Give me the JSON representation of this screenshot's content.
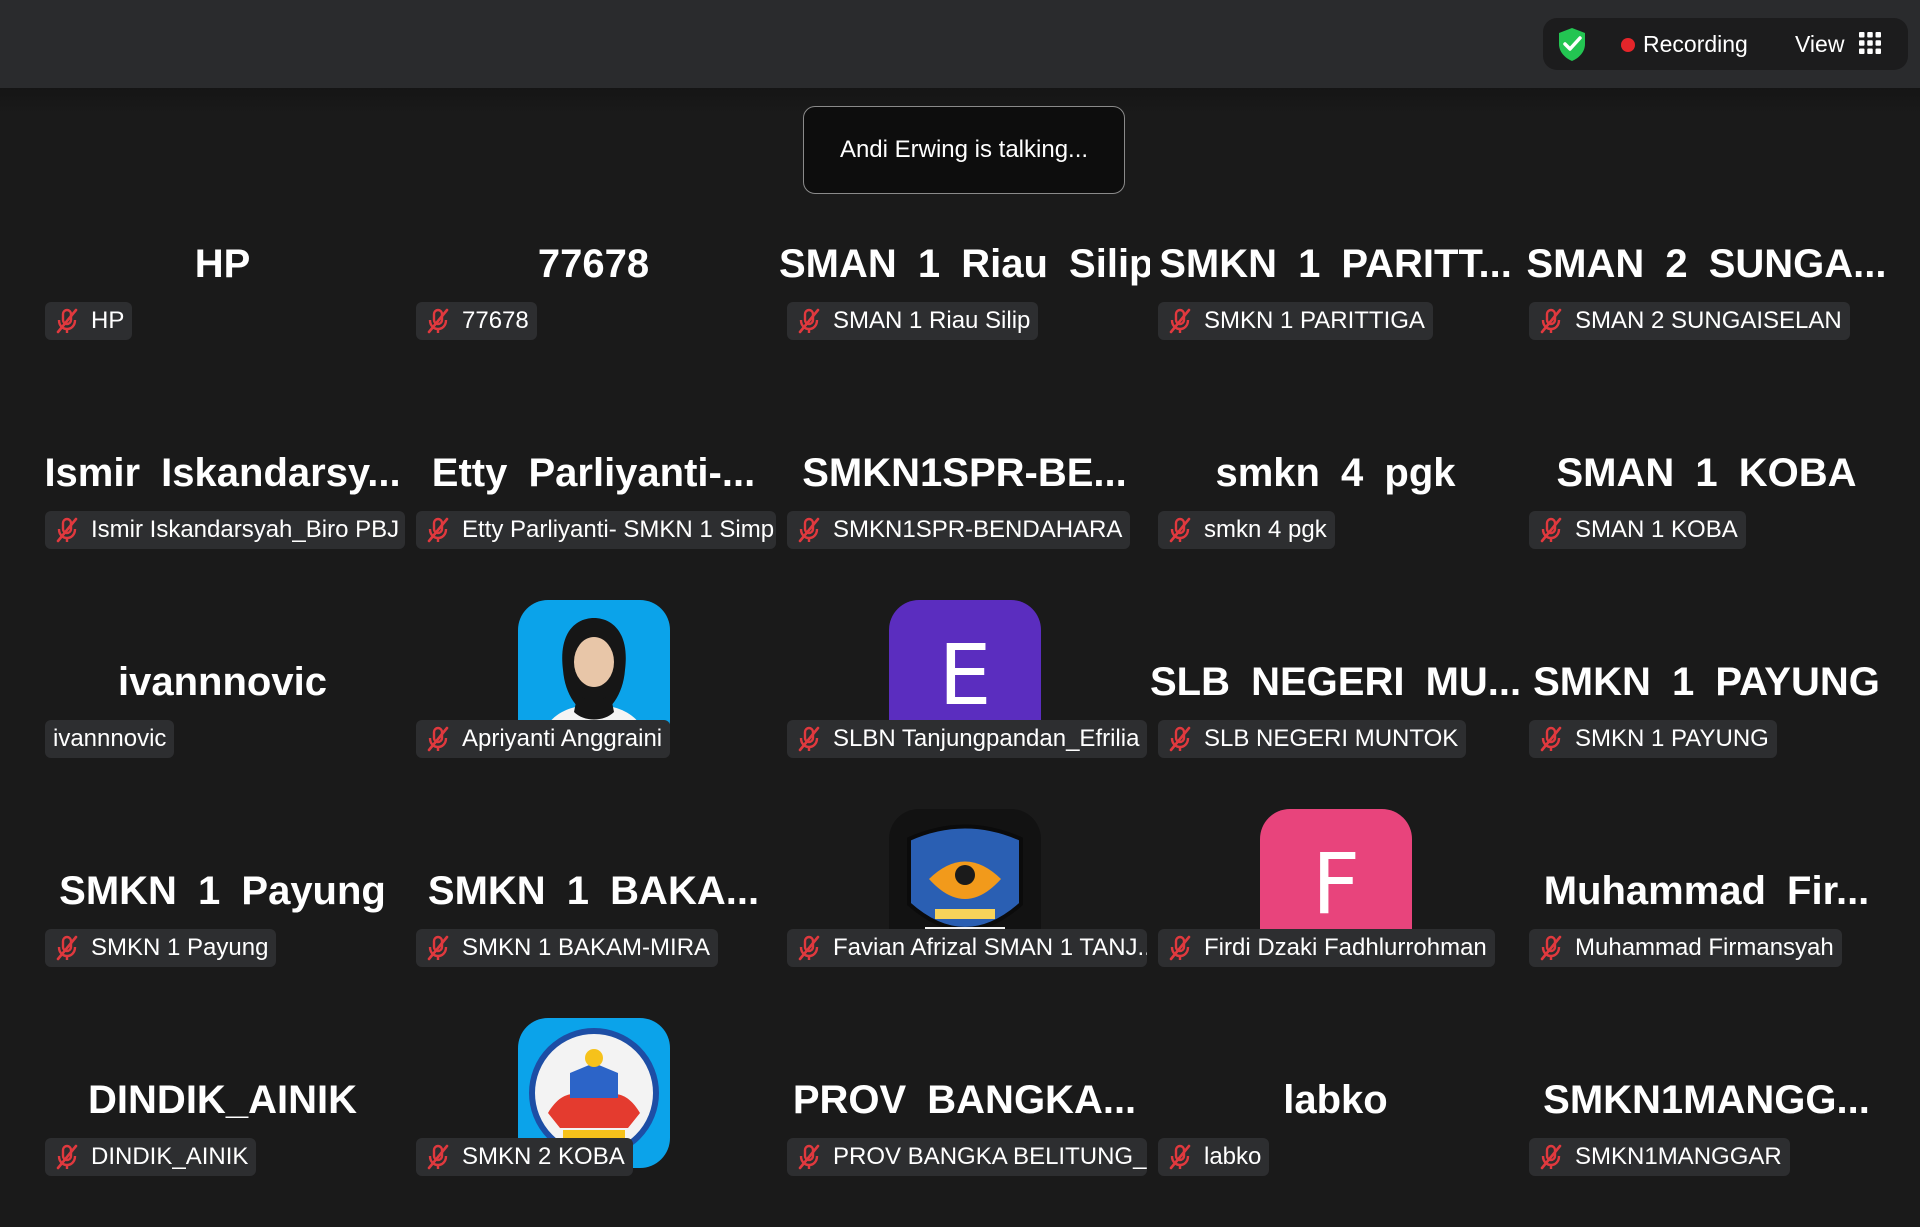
{
  "topbar": {
    "recording_label": "Recording",
    "view_label": "View",
    "shield_icon": "shield-check-icon",
    "grid_icon": "grid-view-icon",
    "colors": {
      "shield": "#23c552",
      "recording_dot": "#e5252a"
    }
  },
  "toast": {
    "text": "Andi Erwing is talking..."
  },
  "tiles": [
    {
      "name": "HP",
      "label": "HP",
      "muted": true
    },
    {
      "name": "77678",
      "label": "77678",
      "muted": true
    },
    {
      "name": "SMAN 1 Riau Silip",
      "label": "SMAN 1 Riau Silip",
      "muted": true
    },
    {
      "name": "SMKN 1 PARITT...",
      "label": "SMKN 1 PARITTIGA",
      "muted": true
    },
    {
      "name": "SMAN 2 SUNGA...",
      "label": "SMAN 2 SUNGAISELAN",
      "muted": true
    },
    {
      "name": "Ismir Iskandarsy...",
      "label": "Ismir Iskandarsyah_Biro PBJ ...",
      "muted": true
    },
    {
      "name": "Etty Parliyanti-...",
      "label": "Etty Parliyanti- SMKN 1 Simp...",
      "muted": true
    },
    {
      "name": "SMKN1SPR-BE...",
      "label": "SMKN1SPR-BENDAHARA",
      "muted": true
    },
    {
      "name": "smkn 4 pgk",
      "label": "smkn 4 pgk",
      "muted": true
    },
    {
      "name": "SMAN 1 KOBA",
      "label": "SMAN 1 KOBA",
      "muted": true
    },
    {
      "name": "ivannnovic",
      "label": "ivannnovic",
      "muted": false
    },
    {
      "name": "",
      "label": "Apriyanti Anggraini",
      "muted": true,
      "avatar": "photo"
    },
    {
      "name": "",
      "label": "SLBN Tanjungpandan_Efrilia ...",
      "muted": true,
      "avatar": "letter",
      "letter": "E",
      "color": "#5b2dbf"
    },
    {
      "name": "SLB NEGERI MU...",
      "label": "SLB NEGERI MUNTOK",
      "muted": true
    },
    {
      "name": "SMKN 1 PAYUNG",
      "label": "SMKN 1 PAYUNG",
      "muted": true
    },
    {
      "name": "SMKN 1 Payung",
      "label": "SMKN 1 Payung",
      "muted": true
    },
    {
      "name": "SMKN 1 BAKA...",
      "label": "SMKN 1 BAKAM-MIRA",
      "muted": true
    },
    {
      "name": "",
      "label": "Favian Afrizal SMAN 1 TANJ...",
      "muted": true,
      "avatar": "logo-sman"
    },
    {
      "name": "",
      "label": "Firdi Dzaki Fadhlurrohman",
      "muted": true,
      "avatar": "letter",
      "letter": "F",
      "color": "#e8447c"
    },
    {
      "name": "Muhammad Fir...",
      "label": "Muhammad Firmansyah",
      "muted": true
    },
    {
      "name": "DINDIK_AINIK",
      "label": "DINDIK_AINIK",
      "muted": true
    },
    {
      "name": "",
      "label": "SMKN 2 KOBA",
      "muted": true,
      "avatar": "logo-smkn"
    },
    {
      "name": "PROV BANGKA...",
      "label": "PROV BANGKA BELITUNG_B...",
      "muted": true
    },
    {
      "name": "labko",
      "label": "labko",
      "muted": true
    },
    {
      "name": "SMKN1MANGG...",
      "label": "SMKN1MANGGAR",
      "muted": true
    }
  ]
}
